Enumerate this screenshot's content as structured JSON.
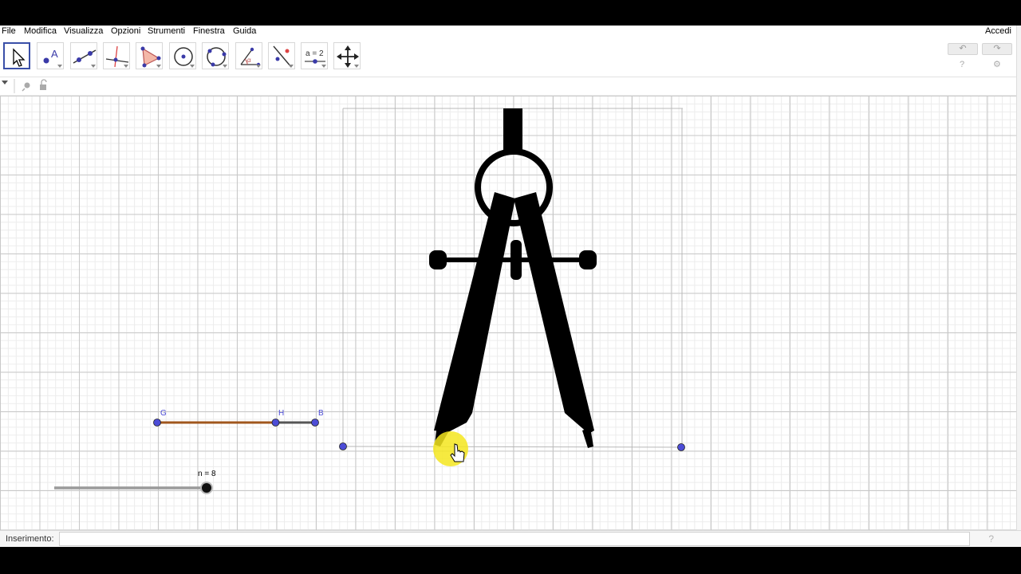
{
  "menu": {
    "items": [
      "File",
      "Modifica",
      "Visualizza",
      "Opzioni",
      "Strumenti",
      "Finestra",
      "Guida"
    ],
    "login": "Accedi"
  },
  "toolbar": {
    "tools": [
      {
        "name": "move-tool",
        "icon": "pointer-arrow-icon",
        "selected": true
      },
      {
        "name": "point-tool",
        "icon": "point-icon",
        "selected": false
      },
      {
        "name": "line-tool",
        "icon": "line-through-points-icon",
        "selected": false
      },
      {
        "name": "perpendicular-line-tool",
        "icon": "perpendicular-line-icon",
        "selected": false
      },
      {
        "name": "polygon-tool",
        "icon": "polygon-icon",
        "selected": false
      },
      {
        "name": "circle-center-point-tool",
        "icon": "circle-center-icon",
        "selected": false
      },
      {
        "name": "circle-three-points-tool",
        "icon": "circle-three-points-icon",
        "selected": false
      },
      {
        "name": "angle-tool",
        "icon": "angle-icon",
        "selected": false
      },
      {
        "name": "reflect-tool",
        "icon": "reflect-about-line-icon",
        "selected": false
      },
      {
        "name": "slider-tool",
        "icon": "slider-icon",
        "label": "a = 2",
        "selected": false
      },
      {
        "name": "move-graphics-view-tool",
        "icon": "move-arrows-icon",
        "selected": false
      }
    ],
    "undo_icon": "undo-icon",
    "redo_icon": "redo-icon",
    "help_icon": "help-icon",
    "settings_icon": "gear-icon"
  },
  "stylebar": {
    "toggle_icon": "triangle-down-icon",
    "pin_icon": "pin-icon",
    "lock_icon": "unlock-icon"
  },
  "graphics": {
    "segment": {
      "start_label": "G",
      "mid_label": "H",
      "end_label": "B",
      "colored_fraction": 0.75
    },
    "slider": {
      "label": "n = 8",
      "value": 8,
      "position_fraction": 1.0
    },
    "compass_icon": "drawing-compass-icon",
    "cursor_icon": "hand-cursor-icon",
    "colors": {
      "point": "#4c4cd6",
      "segment_orange": "#a0561c",
      "segment_gray": "#555555",
      "highlight": "#f5e61e",
      "compass": "#000000"
    }
  },
  "input_bar": {
    "label": "Inserimento:",
    "value": "",
    "help_icon": "help-icon"
  }
}
